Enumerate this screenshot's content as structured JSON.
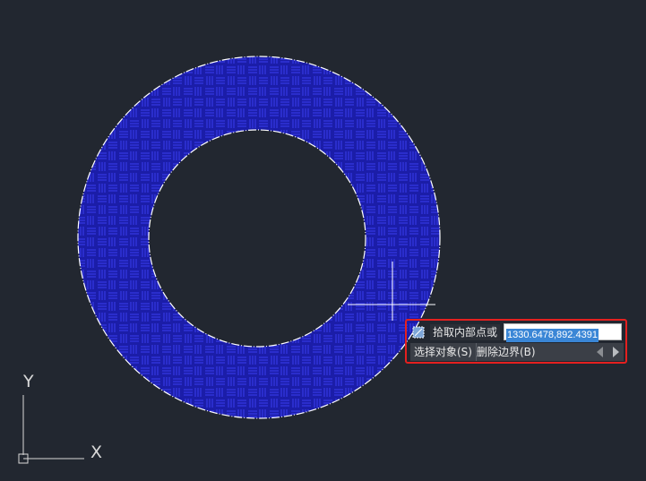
{
  "viewport": {
    "background": "#222730",
    "hatch_color": "#1b1da8",
    "hatch_line_color": "#3437e0",
    "boundary_color": "#ffffff",
    "crosshair_color": "#ffffff"
  },
  "hatch": {
    "pattern": "basket-weave",
    "shape": "annulus"
  },
  "dynamic_input": {
    "prompt": "拾取内部点或",
    "coordinate_value": "1330.6478,892.4391",
    "options": [
      {
        "label": "选择对象(S)"
      },
      {
        "label": "删除边界(B)"
      }
    ],
    "highlight_color": "#e5201f",
    "icons": {
      "pick": "pick-point-icon",
      "prev": "arrow-left-icon",
      "next": "arrow-right-icon"
    }
  },
  "ucs": {
    "x_label": "X",
    "y_label": "Y",
    "icon": "ucs-icon"
  }
}
